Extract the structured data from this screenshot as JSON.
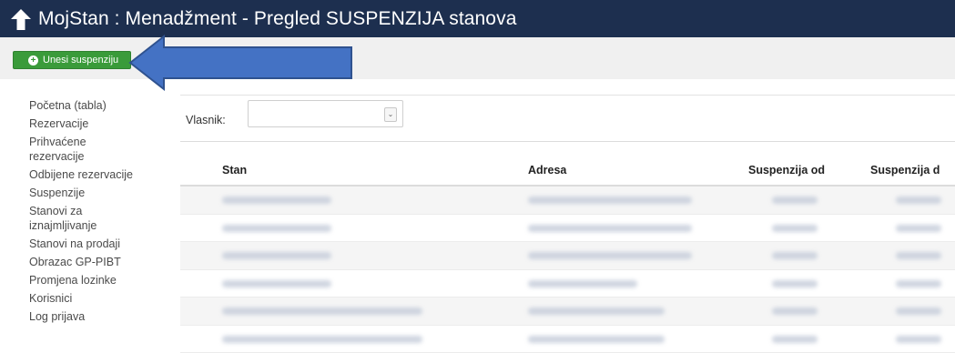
{
  "header": {
    "title": "MojStan : Menadžment - Pregled SUSPENZIJA stanova"
  },
  "toolbar": {
    "add_label": "Unesi suspenziju"
  },
  "sidebar": {
    "items": [
      "Početna (tabla)",
      "Rezervacije",
      "Prihvaćene rezervacije",
      "Odbijene rezervacije",
      "Suspenzije",
      "Stanovi za iznajmljivanje",
      "Stanovi na prodaji",
      "Obrazac GP-PIBT",
      "Promjena lozinke",
      "Korisnici",
      "Log prijava"
    ]
  },
  "filter": {
    "label": "Vlasnik:",
    "value": ""
  },
  "table": {
    "headers": [
      "Stan",
      "Adresa",
      "Suspenzija od",
      "Suspenzija d"
    ],
    "rows_note_blurred": [
      1,
      2,
      3,
      4,
      5,
      6
    ]
  },
  "colors": {
    "titlebar": "#1d2f4f",
    "button": "#3a9b3a",
    "arrow": "#4472c4"
  }
}
